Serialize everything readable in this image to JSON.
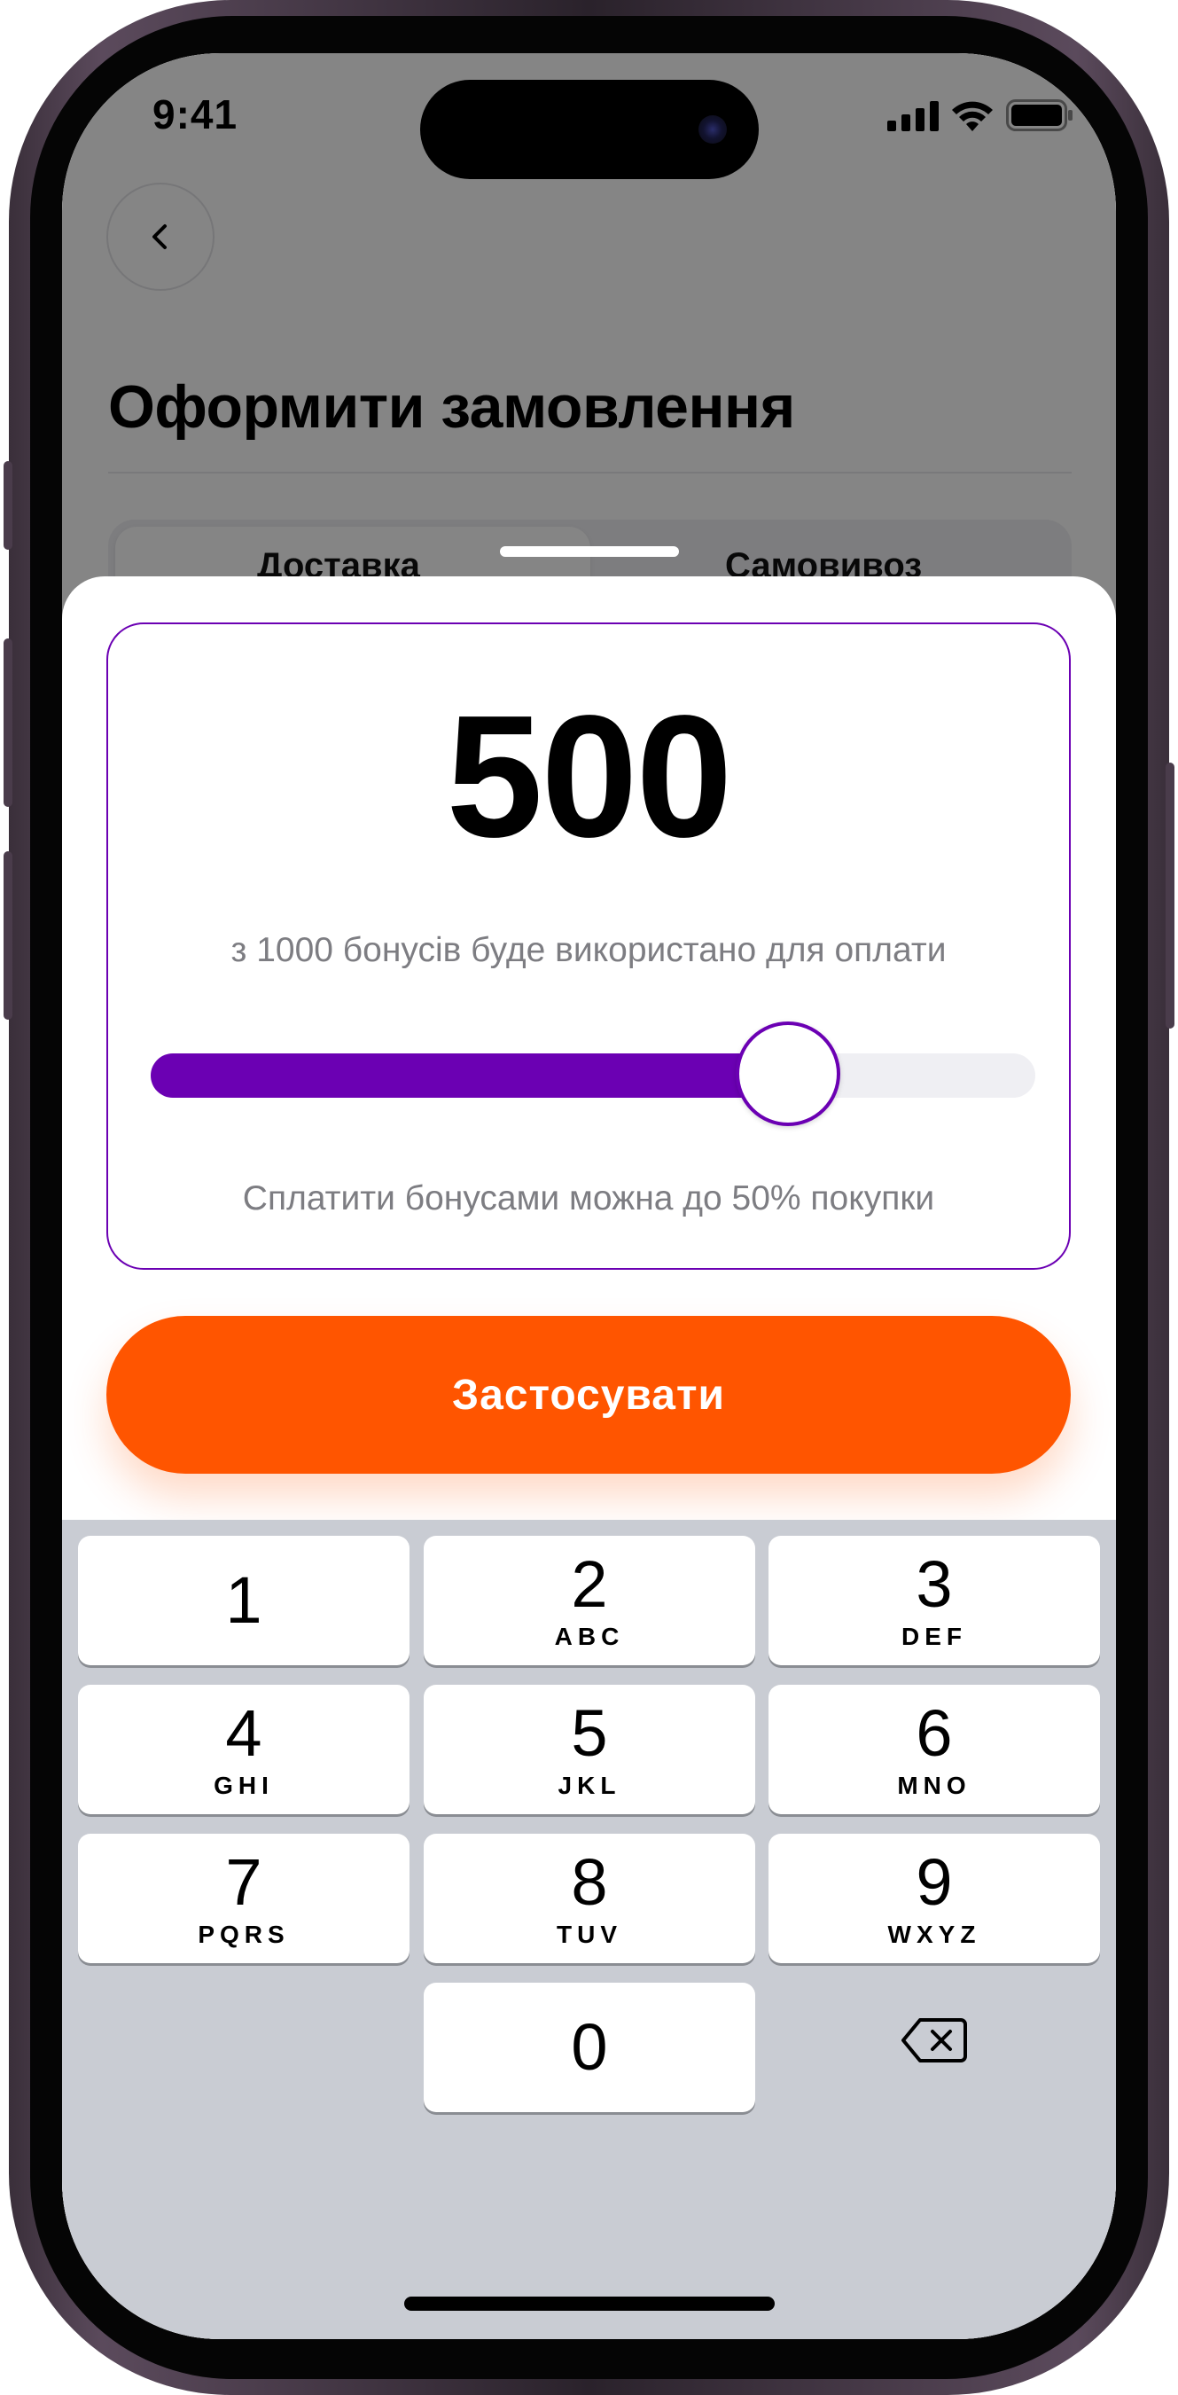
{
  "status_bar": {
    "time": "9:41"
  },
  "page": {
    "title": "Оформити замовлення",
    "tabs": [
      {
        "label": "Доставка",
        "selected": true
      },
      {
        "label": "Самовивоз",
        "selected": false
      }
    ]
  },
  "bonus_sheet": {
    "amount": "500",
    "subtitle": "з 1000 бонусів буде використано для оплати",
    "slider_value_fraction": 0.75,
    "note": "Сплатити бонусами можна до 50% покупки",
    "apply_label": "Застосувати"
  },
  "keyboard": {
    "keys": [
      {
        "digit": "1",
        "letters": ""
      },
      {
        "digit": "2",
        "letters": "ABC"
      },
      {
        "digit": "3",
        "letters": "DEF"
      },
      {
        "digit": "4",
        "letters": "GHI"
      },
      {
        "digit": "5",
        "letters": "JKL"
      },
      {
        "digit": "6",
        "letters": "MNO"
      },
      {
        "digit": "7",
        "letters": "PQRS"
      },
      {
        "digit": "8",
        "letters": "TUV"
      },
      {
        "digit": "9",
        "letters": "WXYZ"
      },
      {
        "digit": "0",
        "letters": ""
      }
    ]
  },
  "colors": {
    "accent_purple": "#6b00b3",
    "button_orange": "#ff5500",
    "keyboard_bg": "#c9ccd3"
  },
  "icons": [
    "back-chevron-icon",
    "signal-icon",
    "wifi-icon",
    "battery-icon",
    "delete-icon"
  ]
}
